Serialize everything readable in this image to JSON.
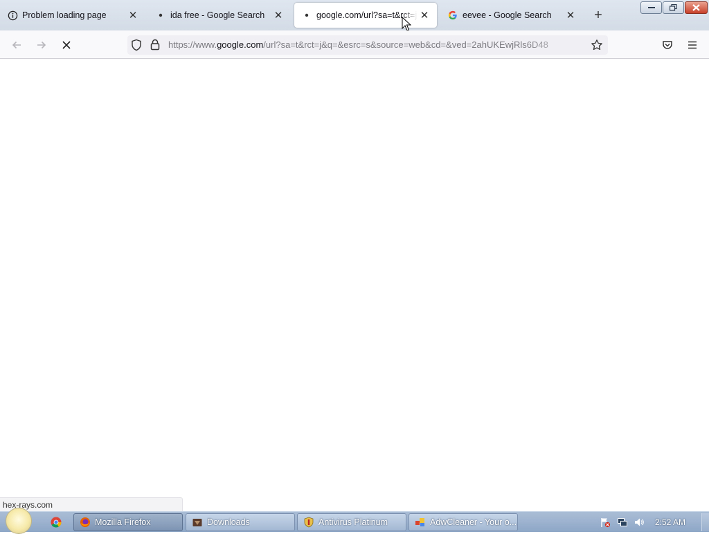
{
  "tabs": [
    {
      "title": "Problem loading page",
      "icon": "info-icon",
      "active": false
    },
    {
      "title": "ida free - Google Search",
      "icon": "loading-dot-icon",
      "active": false
    },
    {
      "title": "google.com/url?sa=t&rct=j",
      "icon": "loading-dot-icon",
      "active": true
    },
    {
      "title": "eevee - Google Search",
      "icon": "google-g-icon",
      "active": false
    }
  ],
  "toolbar": {
    "url_prefix": "https://www.",
    "url_domain": "google.com",
    "url_rest": "/url?sa=t&rct=j&q=&esrc=s&source=web&cd=&ved=2ahUKEwjRls6D48"
  },
  "status_link": "hex-rays.com",
  "taskbar": {
    "items": [
      {
        "label": "Mozilla Firefox",
        "icon": "firefox-icon",
        "active": true
      },
      {
        "label": "Downloads",
        "icon": "folder-icon",
        "active": false
      },
      {
        "label": "Antivirus Platinum",
        "icon": "shield-icon",
        "active": false
      },
      {
        "label": "AdwCleaner - Your o...",
        "icon": "adwcleaner-icon",
        "active": false
      }
    ],
    "clock": "2:52 AM"
  },
  "colors": {
    "tabstrip": "#d3dbe6",
    "active_tab": "#ffffff",
    "taskbar": "#8ea7c7"
  }
}
